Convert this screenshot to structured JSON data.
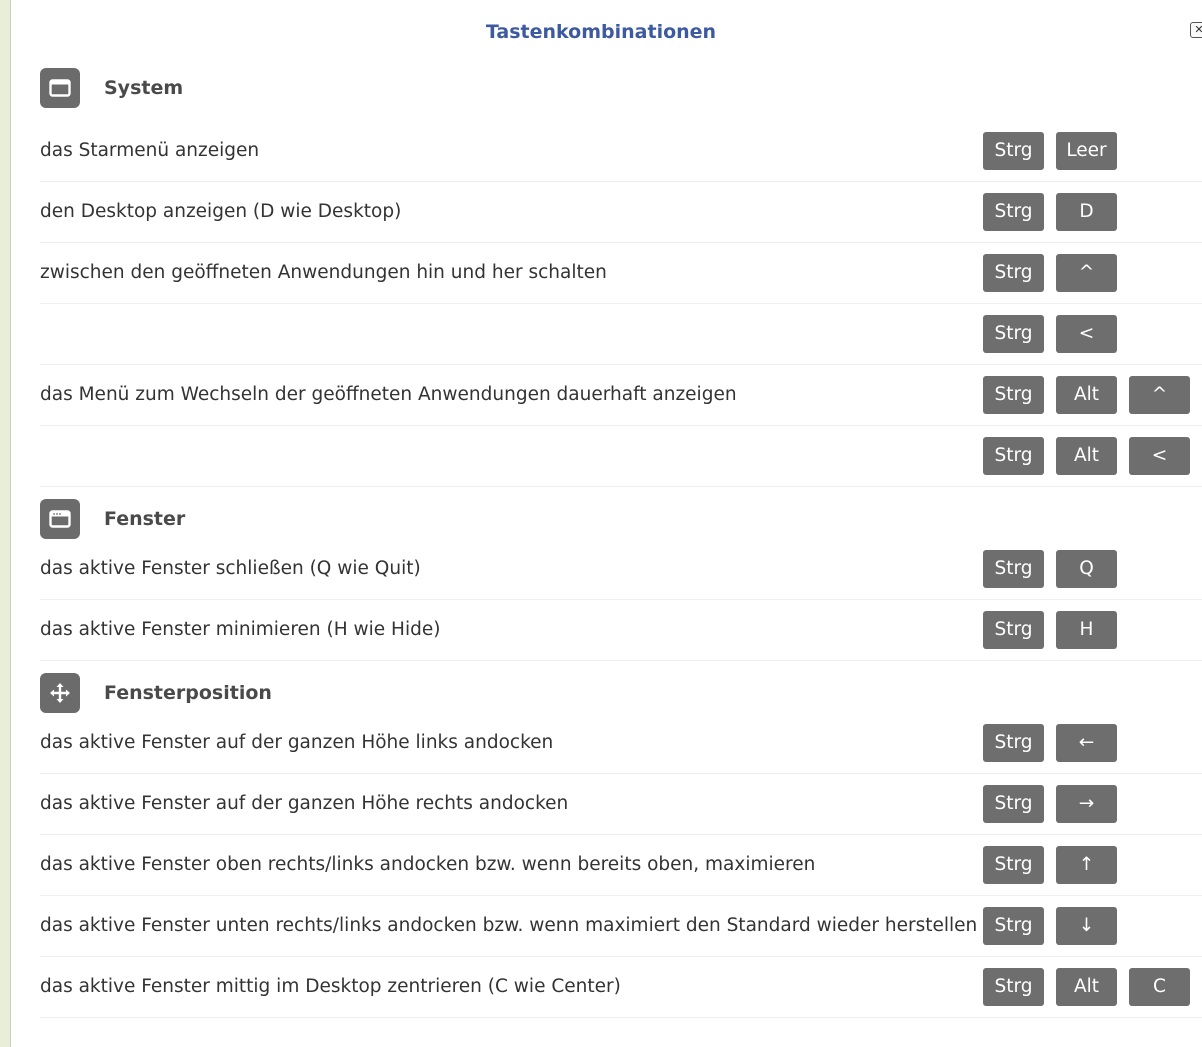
{
  "dialog": {
    "title": "Tastenkombinationen",
    "close_icon": "close-icon"
  },
  "sections": [
    {
      "label": "System",
      "icon": "window-icon",
      "rows": [
        {
          "desc": "das Starmenü anzeigen",
          "keys": [
            "Strg",
            "Leer"
          ]
        },
        {
          "desc": "den Desktop anzeigen (D wie Desktop)",
          "keys": [
            "Strg",
            "D"
          ]
        },
        {
          "desc": "zwischen den geöffneten Anwendungen hin und her schalten",
          "keys": [
            "Strg",
            "^"
          ]
        },
        {
          "desc": "",
          "keys": [
            "Strg",
            "<"
          ]
        },
        {
          "desc": "das Menü zum Wechseln der geöffneten Anwendungen dauerhaft anzeigen",
          "keys": [
            "Strg",
            "Alt",
            "^"
          ]
        },
        {
          "desc": "",
          "keys": [
            "Strg",
            "Alt",
            "<"
          ]
        }
      ]
    },
    {
      "label": "Fenster",
      "icon": "window-titlebar-icon",
      "rows": [
        {
          "desc": "das aktive Fenster schließen (Q wie Quit)",
          "keys": [
            "Strg",
            "Q"
          ]
        },
        {
          "desc": "das aktive Fenster minimieren (H wie Hide)",
          "keys": [
            "Strg",
            "H"
          ]
        }
      ]
    },
    {
      "label": "Fensterposition",
      "icon": "move-arrows-icon",
      "rows": [
        {
          "desc": "das aktive Fenster auf der ganzen Höhe links andocken",
          "keys": [
            "Strg",
            "←"
          ]
        },
        {
          "desc": "das aktive Fenster auf der ganzen Höhe rechts andocken",
          "keys": [
            "Strg",
            "→"
          ]
        },
        {
          "desc": "das aktive Fenster oben rechts/links andocken bzw. wenn bereits oben, maximieren",
          "keys": [
            "Strg",
            "↑"
          ]
        },
        {
          "desc": "das aktive Fenster unten rechts/links andocken bzw. wenn maximiert den Standard wieder herstellen",
          "keys": [
            "Strg",
            "↓"
          ]
        },
        {
          "desc": "das aktive Fenster mittig im Desktop zentrieren (C wie Center)",
          "keys": [
            "Strg",
            "Alt",
            "C"
          ]
        }
      ]
    }
  ]
}
